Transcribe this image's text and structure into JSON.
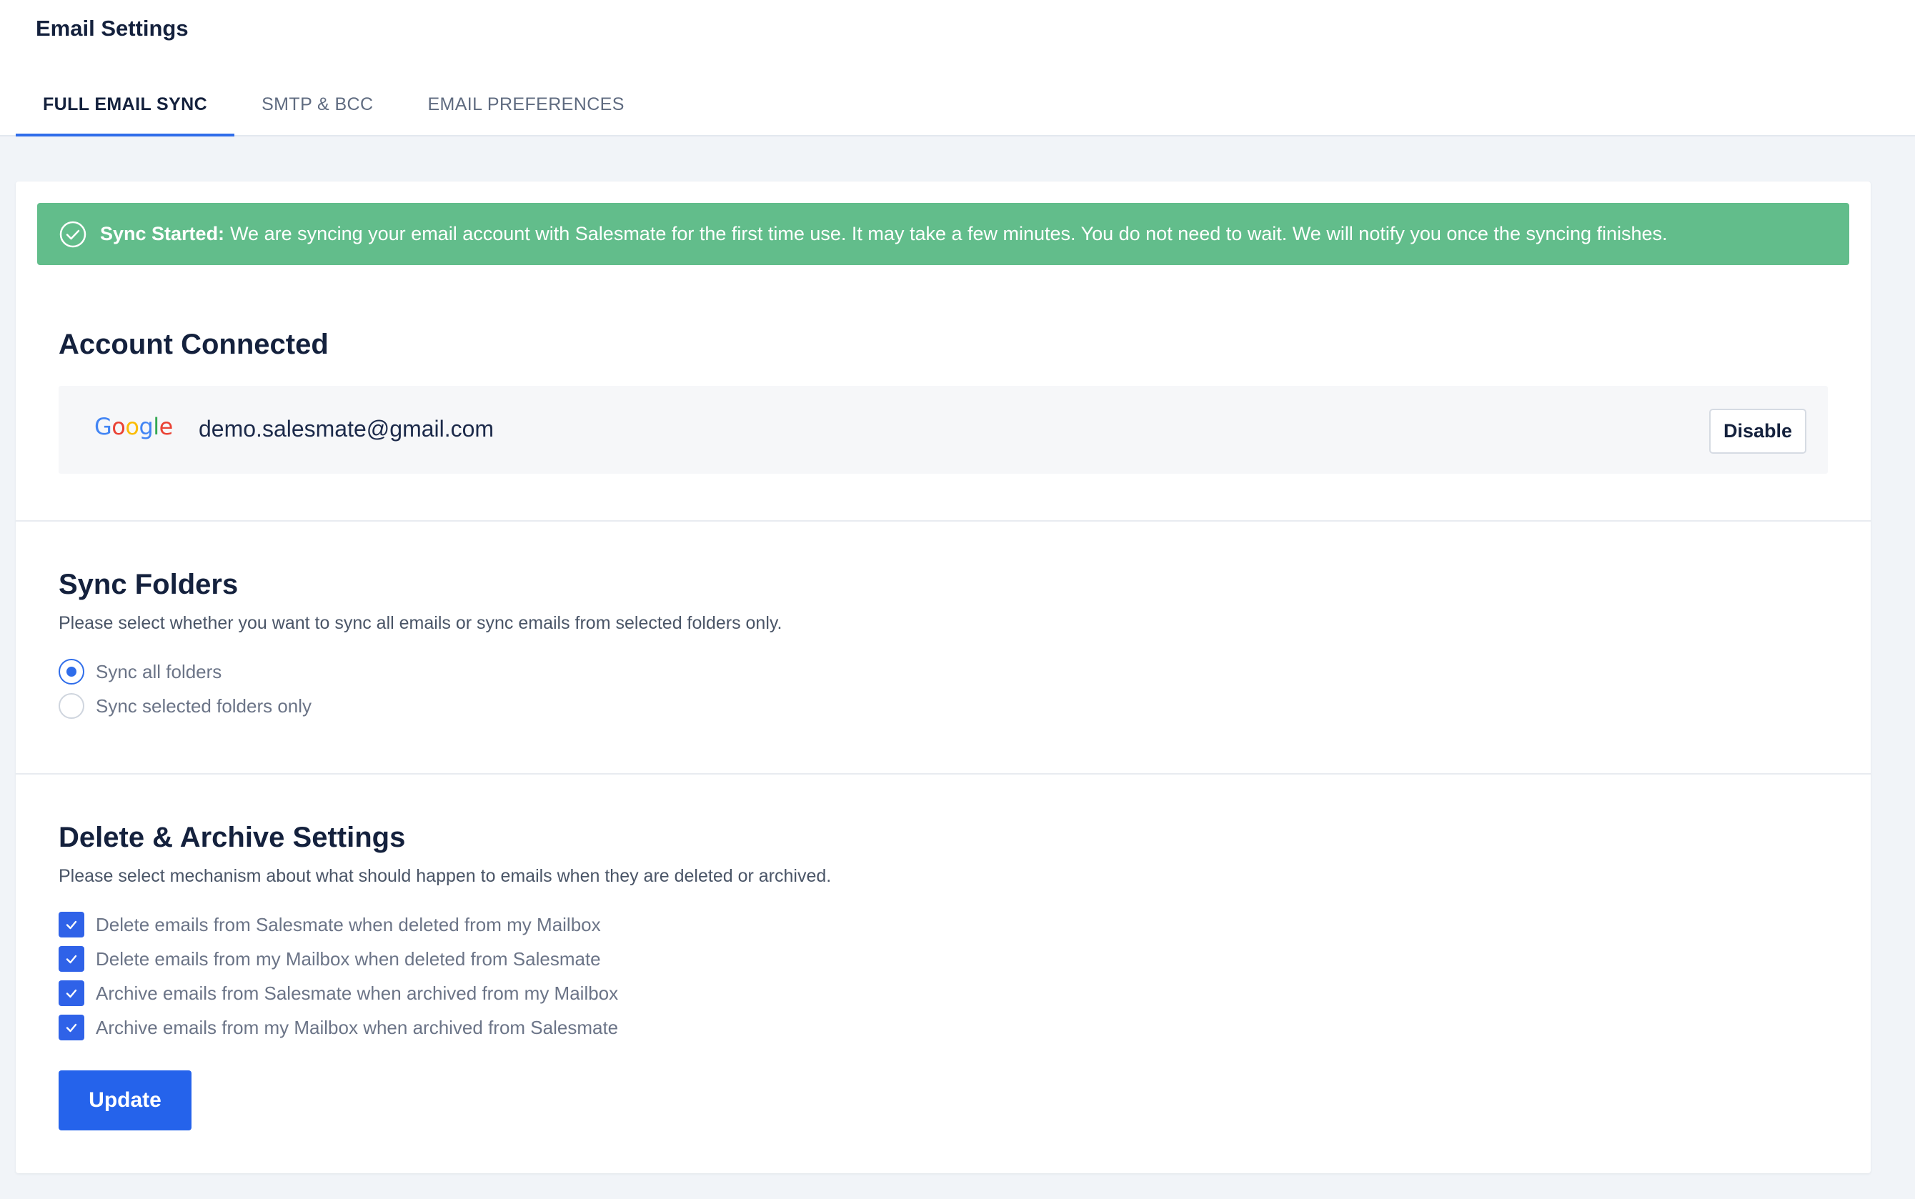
{
  "page": {
    "title": "Email Settings"
  },
  "tabs": [
    {
      "label": "FULL EMAIL SYNC",
      "active": true
    },
    {
      "label": "SMTP & BCC",
      "active": false
    },
    {
      "label": "EMAIL PREFERENCES",
      "active": false
    }
  ],
  "banner": {
    "icon": "check-circle-icon",
    "title": "Sync Started:",
    "message": "We are syncing your email account with Salesmate for the first time use. It may take a few minutes. You do not need to wait. We will notify you once the syncing finishes.",
    "color": "#62bd8b"
  },
  "account": {
    "title": "Account Connected",
    "provider_logo": "Google",
    "email": "demo.salesmate@gmail.com",
    "disable_label": "Disable"
  },
  "sync_folders": {
    "title": "Sync Folders",
    "description": "Please select whether you want to sync all emails or sync emails from selected folders only.",
    "options": [
      {
        "label": "Sync all folders",
        "selected": true
      },
      {
        "label": "Sync selected folders only",
        "selected": false
      }
    ]
  },
  "delete_archive": {
    "title": "Delete & Archive Settings",
    "description": "Please select mechanism about what should happen to emails when they are deleted or archived.",
    "options": [
      {
        "label": "Delete emails from Salesmate when deleted from my Mailbox",
        "checked": true
      },
      {
        "label": "Delete emails from my Mailbox when deleted from Salesmate",
        "checked": true
      },
      {
        "label": "Archive emails from Salesmate when archived from my Mailbox",
        "checked": true
      },
      {
        "label": "Archive emails from my Mailbox when archived from Salesmate",
        "checked": true
      }
    ]
  },
  "actions": {
    "update_label": "Update"
  },
  "colors": {
    "accent": "#2f6dea",
    "primary_button": "#2563eb",
    "success": "#62bd8b"
  }
}
